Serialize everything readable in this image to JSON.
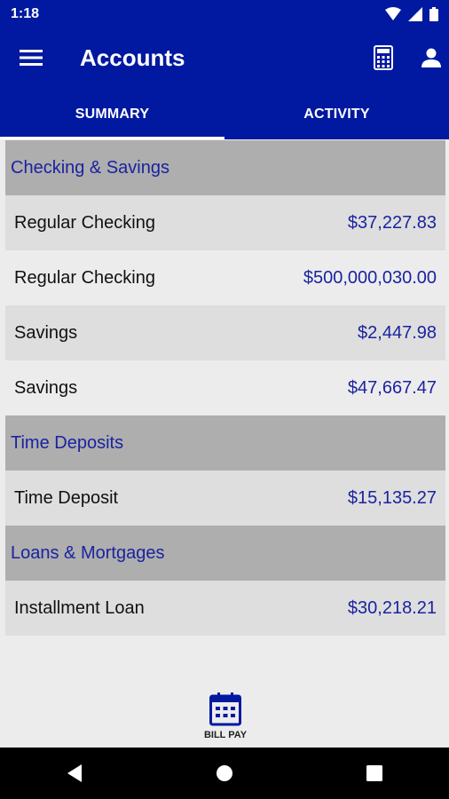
{
  "status": {
    "time": "1:18"
  },
  "app_bar": {
    "title": "Accounts"
  },
  "tabs": [
    {
      "label": "SUMMARY",
      "active": true
    },
    {
      "label": "ACTIVITY",
      "active": false
    }
  ],
  "sections": [
    {
      "title": "Checking & Savings",
      "accounts": [
        {
          "name": "Regular Checking",
          "balance": "$37,227.83"
        },
        {
          "name": "Regular Checking",
          "balance": "$500,000,030.00"
        },
        {
          "name": "Savings",
          "balance": "$2,447.98"
        },
        {
          "name": "Savings",
          "balance": "$47,667.47"
        }
      ]
    },
    {
      "title": "Time Deposits",
      "accounts": [
        {
          "name": "Time Deposit",
          "balance": "$15,135.27"
        }
      ]
    },
    {
      "title": "Loans & Mortgages",
      "accounts": [
        {
          "name": "Installment Loan",
          "balance": "$30,218.21"
        }
      ]
    }
  ],
  "bottom_action": {
    "label": "BILL PAY",
    "icon": "calendar-icon"
  },
  "colors": {
    "primary": "#0019a0",
    "section_text": "#1a23a0",
    "section_bg": "#aeaeae",
    "row_shade": "#dedede",
    "background": "#ececec"
  }
}
